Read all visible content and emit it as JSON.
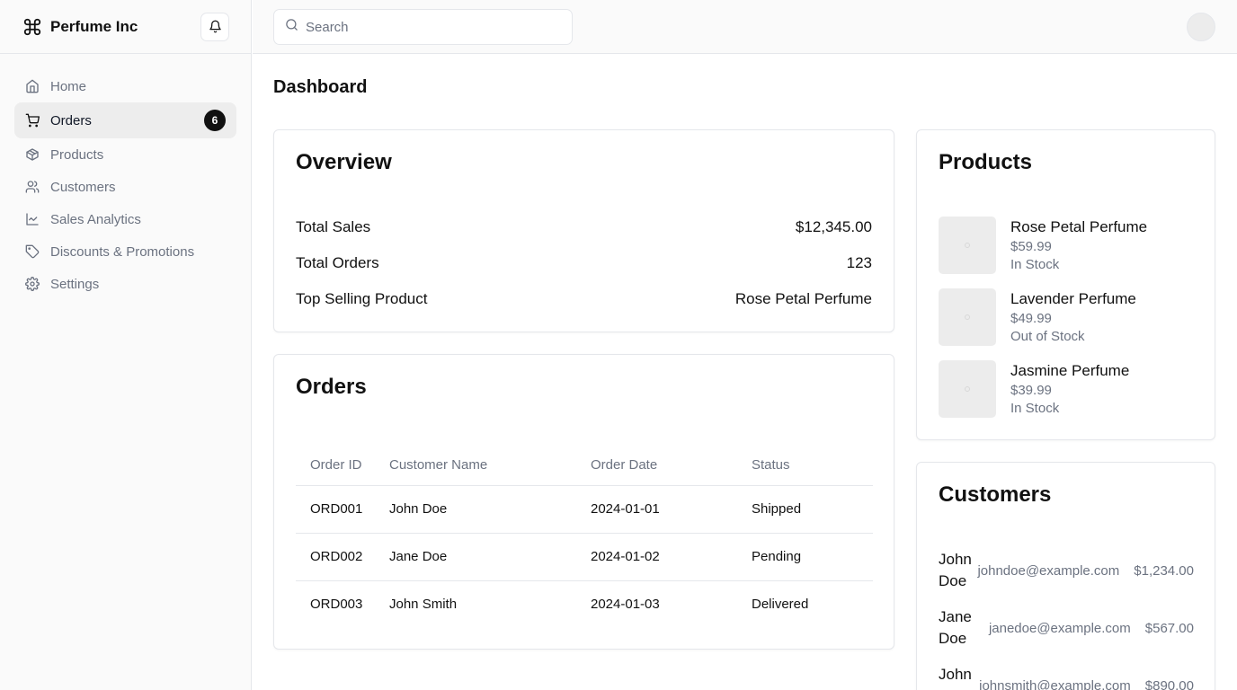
{
  "brand": {
    "name": "Perfume Inc",
    "logo_icon": "clover-icon"
  },
  "sidebar": {
    "items": [
      {
        "label": "Home",
        "icon": "home-icon"
      },
      {
        "label": "Orders",
        "icon": "cart-icon",
        "badge": "6",
        "active": true
      },
      {
        "label": "Products",
        "icon": "package-icon"
      },
      {
        "label": "Customers",
        "icon": "users-icon"
      },
      {
        "label": "Sales Analytics",
        "icon": "line-chart-icon"
      },
      {
        "label": "Discounts & Promotions",
        "icon": "tag-icon"
      },
      {
        "label": "Settings",
        "icon": "gear-icon"
      }
    ]
  },
  "header": {
    "search_placeholder": "Search"
  },
  "page": {
    "title": "Dashboard"
  },
  "overview": {
    "title": "Overview",
    "rows": [
      {
        "label": "Total Sales",
        "value": "$12,345.00"
      },
      {
        "label": "Total Orders",
        "value": "123"
      },
      {
        "label": "Top Selling Product",
        "value": "Rose Petal Perfume"
      }
    ]
  },
  "orders": {
    "title": "Orders",
    "columns": [
      "Order ID",
      "Customer Name",
      "Order Date",
      "Status"
    ],
    "rows": [
      [
        "ORD001",
        "John Doe",
        "2024-01-01",
        "Shipped"
      ],
      [
        "ORD002",
        "Jane Doe",
        "2024-01-02",
        "Pending"
      ],
      [
        "ORD003",
        "John Smith",
        "2024-01-03",
        "Delivered"
      ]
    ]
  },
  "products": {
    "title": "Products",
    "items": [
      {
        "name": "Rose Petal Perfume",
        "price": "$59.99",
        "stock": "In Stock"
      },
      {
        "name": "Lavender Perfume",
        "price": "$49.99",
        "stock": "Out of Stock"
      },
      {
        "name": "Jasmine Perfume",
        "price": "$39.99",
        "stock": "In Stock"
      }
    ]
  },
  "customers": {
    "title": "Customers",
    "items": [
      {
        "name": "John Doe",
        "email": "johndoe@example.com",
        "total": "$1,234.00"
      },
      {
        "name": "Jane Doe",
        "email": "janedoe@example.com",
        "total": "$567.00"
      },
      {
        "name": "John Smith",
        "email": "johnsmith@example.com",
        "total": "$890.00"
      }
    ]
  },
  "colors": {
    "accent": "#111111",
    "muted_text": "#6b7280",
    "border": "#e5e7eb",
    "sidebar_bg": "#fafafa"
  }
}
